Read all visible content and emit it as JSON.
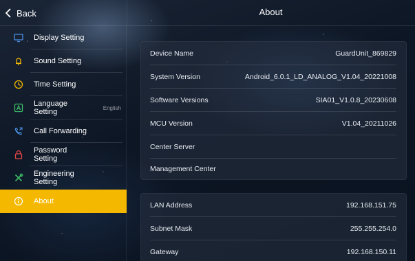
{
  "header": {
    "back_label": "Back",
    "title": "About"
  },
  "sidebar": {
    "items": [
      {
        "label": "Display Setting",
        "icon": "monitor-icon",
        "value": ""
      },
      {
        "label": "Sound Setting",
        "icon": "bell-icon",
        "value": ""
      },
      {
        "label": "Time Setting",
        "icon": "clock-icon",
        "value": ""
      },
      {
        "label": "Language Setting",
        "icon": "language-icon",
        "value": "English"
      },
      {
        "label": "Call Forwarding",
        "icon": "phone-forward-icon",
        "value": ""
      },
      {
        "label": "Password Setting",
        "icon": "lock-icon",
        "value": ""
      },
      {
        "label": "Engineering Setting",
        "icon": "tools-icon",
        "value": ""
      },
      {
        "label": "About",
        "icon": "info-icon",
        "value": "",
        "active": true
      }
    ]
  },
  "device_info": [
    {
      "label": "Device Name",
      "value": "GuardUnit_869829"
    },
    {
      "label": "System Version",
      "value": "Android_6.0.1_LD_ANALOG_V1.04_20221008"
    },
    {
      "label": "Software Versions",
      "value": "SIA01_V1.0.8_20230608"
    },
    {
      "label": "MCU Version",
      "value": "V1.04_20211026"
    },
    {
      "label": "Center Server",
      "value": ""
    },
    {
      "label": "Management Center",
      "value": ""
    }
  ],
  "network_info": [
    {
      "label": "LAN Address",
      "value": "192.168.151.75"
    },
    {
      "label": "Subnet Mask",
      "value": "255.255.254.0"
    },
    {
      "label": "Gateway",
      "value": "192.168.150.11"
    }
  ],
  "colors": {
    "accent": "#f5b800",
    "icon_blue": "#4a90e2",
    "icon_red": "#e64545",
    "icon_green": "#3fbf6a",
    "icon_yellow": "#f5b800"
  }
}
